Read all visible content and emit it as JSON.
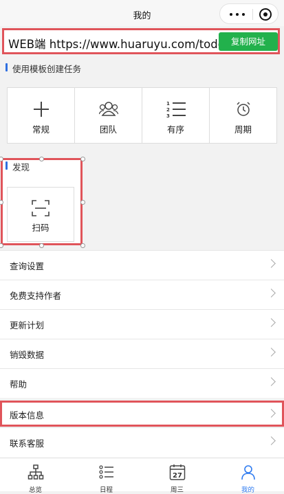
{
  "header": {
    "title": "我的"
  },
  "url_bar": {
    "text": "WEB端 https://www.huaruyu.com/todo",
    "copy_label": "复制网址"
  },
  "templates": {
    "section_label": "使用模板创建任务",
    "items": [
      {
        "label": "常规",
        "icon": "plus-icon"
      },
      {
        "label": "团队",
        "icon": "team-icon"
      },
      {
        "label": "有序",
        "icon": "ordered-list-icon"
      },
      {
        "label": "周期",
        "icon": "alarm-clock-icon"
      }
    ]
  },
  "discover": {
    "section_label": "发现",
    "scan_label": "扫码",
    "scan_icon": "scan-icon"
  },
  "menu": [
    {
      "label": "查询设置"
    },
    {
      "label": "免费支持作者"
    },
    {
      "label": "更新计划"
    },
    {
      "label": "销毁数据"
    },
    {
      "label": "帮助"
    },
    {
      "label": "版本信息"
    },
    {
      "label": "联系客服"
    }
  ],
  "tabs": [
    {
      "label": "总览",
      "icon": "hierarchy-icon"
    },
    {
      "label": "日程",
      "icon": "list-icon"
    },
    {
      "label": "周三",
      "icon": "calendar-icon",
      "day": "27"
    },
    {
      "label": "我的",
      "icon": "person-icon",
      "active": true
    }
  ],
  "colors": {
    "accent": "#22b14c",
    "highlight": "#e0545a",
    "active_tab": "#2f7bf0",
    "section_bar": "#2f6fe0"
  }
}
